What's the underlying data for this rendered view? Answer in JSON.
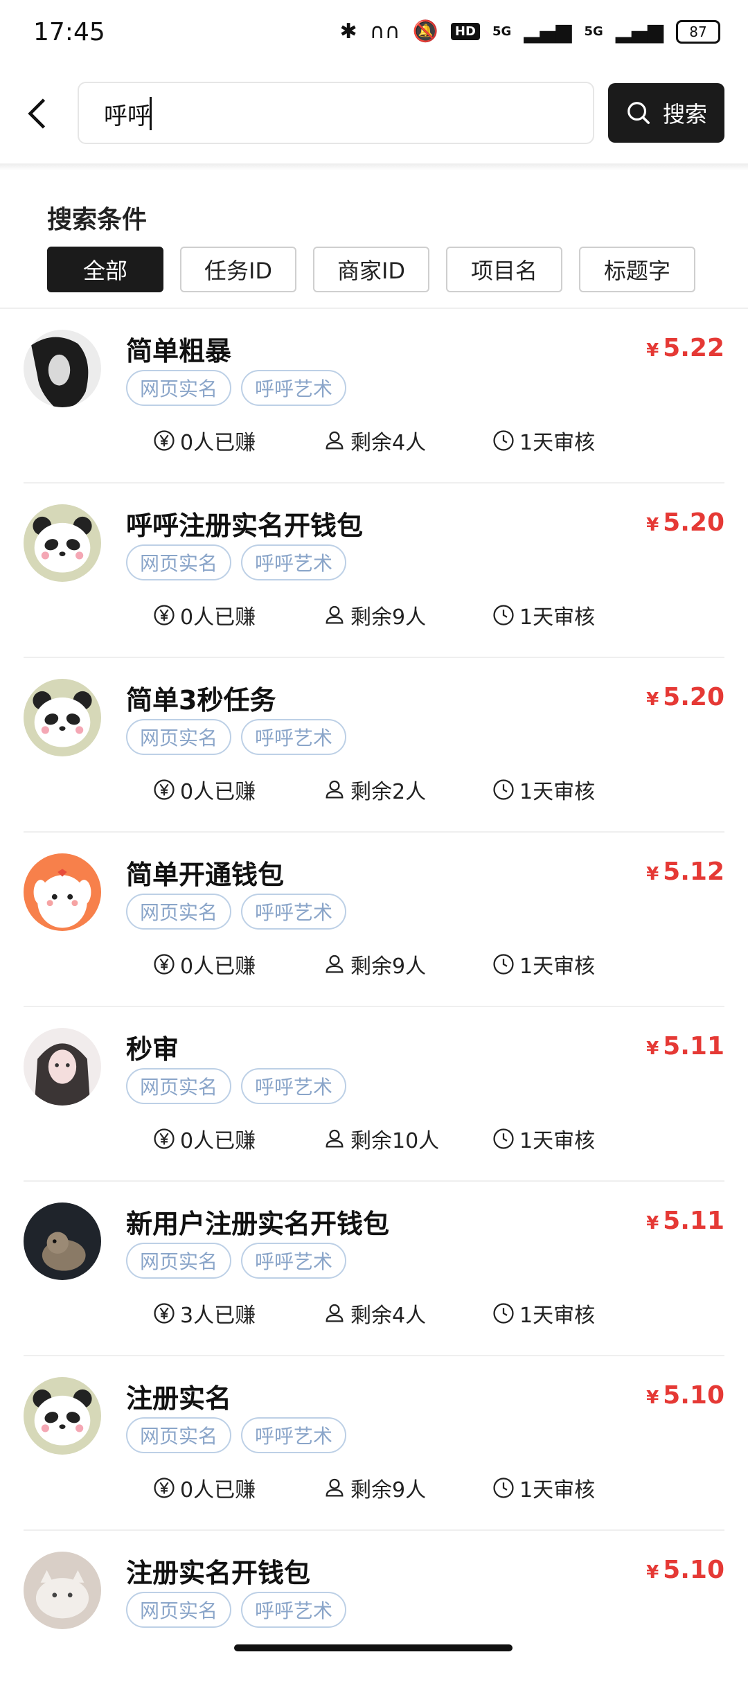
{
  "status_bar": {
    "time": "17:45",
    "hd": "HD",
    "net1": "5G",
    "net2": "5G",
    "battery": "87"
  },
  "header": {
    "search_value": "呼呼",
    "search_button": "搜索"
  },
  "filter": {
    "title": "搜索条件",
    "chips": [
      "全部",
      "任务ID",
      "商家ID",
      "项目名",
      "标题字"
    ],
    "active_index": 0
  },
  "tasks": [
    {
      "title": "简单粗暴",
      "currency": "¥",
      "price": "5.22",
      "tags": [
        "网页实名",
        "呼呼艺术"
      ],
      "earned": "0人已赚",
      "remaining": "剩余4人",
      "review": "1天审核",
      "avatar": "portrait-bw"
    },
    {
      "title": "呼呼注册实名开钱包",
      "currency": "¥",
      "price": "5.20",
      "tags": [
        "网页实名",
        "呼呼艺术"
      ],
      "earned": "0人已赚",
      "remaining": "剩余9人",
      "review": "1天审核",
      "avatar": "panda"
    },
    {
      "title": "简单3秒任务",
      "currency": "¥",
      "price": "5.20",
      "tags": [
        "网页实名",
        "呼呼艺术"
      ],
      "earned": "0人已赚",
      "remaining": "剩余2人",
      "review": "1天审核",
      "avatar": "panda"
    },
    {
      "title": "简单开通钱包",
      "currency": "¥",
      "price": "5.12",
      "tags": [
        "网页实名",
        "呼呼艺术"
      ],
      "earned": "0人已赚",
      "remaining": "剩余9人",
      "review": "1天审核",
      "avatar": "dog-cartoon"
    },
    {
      "title": "秒审",
      "currency": "¥",
      "price": "5.11",
      "tags": [
        "网页实名",
        "呼呼艺术"
      ],
      "earned": "0人已赚",
      "remaining": "剩余10人",
      "review": "1天审核",
      "avatar": "girl-portrait"
    },
    {
      "title": "新用户注册实名开钱包",
      "currency": "¥",
      "price": "5.11",
      "tags": [
        "网页实名",
        "呼呼艺术"
      ],
      "earned": "3人已赚",
      "remaining": "剩余4人",
      "review": "1天审核",
      "avatar": "cat-dark"
    },
    {
      "title": "注册实名",
      "currency": "¥",
      "price": "5.10",
      "tags": [
        "网页实名",
        "呼呼艺术"
      ],
      "earned": "0人已赚",
      "remaining": "剩余9人",
      "review": "1天审核",
      "avatar": "panda"
    },
    {
      "title": "注册实名开钱包",
      "currency": "¥",
      "price": "5.10",
      "tags": [
        "网页实名",
        "呼呼艺术"
      ],
      "earned": "",
      "remaining": "",
      "review": "",
      "avatar": "cat-light"
    }
  ],
  "colors": {
    "price": "#e53935",
    "tag_text": "#8aa5c9",
    "tag_border": "#bdd0e6",
    "dark_button": "#1b1b1b"
  }
}
